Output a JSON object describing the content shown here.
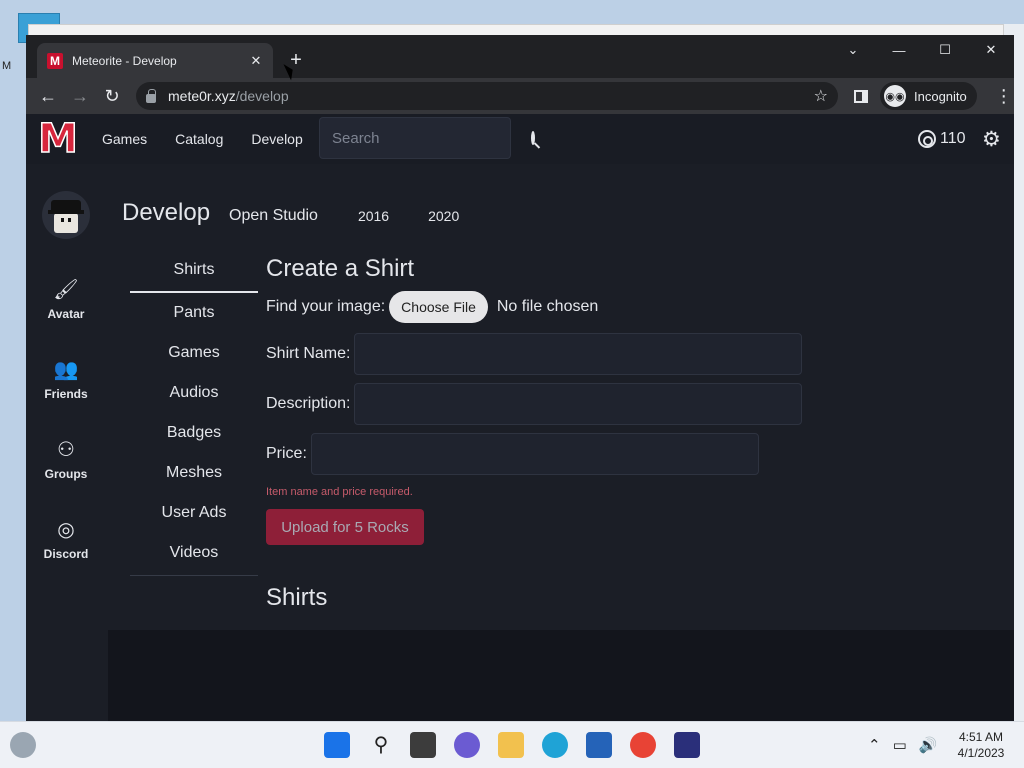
{
  "desktop": {
    "partial_label": "M"
  },
  "browser": {
    "tab_title": "Meteorite - Develop",
    "favicon_letter": "M",
    "url_host": "mete0r.xyz",
    "url_path": "/develop",
    "incognito_label": "Incognito"
  },
  "site": {
    "logo_letter": "M",
    "nav": [
      "Games",
      "Catalog",
      "Develop"
    ],
    "search_placeholder": "Search",
    "rocks": "110"
  },
  "sidebar": {
    "items": [
      {
        "label": "Avatar",
        "icon": "brush-icon"
      },
      {
        "label": "Friends",
        "icon": "friends-icon"
      },
      {
        "label": "Groups",
        "icon": "groups-icon"
      },
      {
        "label": "Discord",
        "icon": "discord-icon"
      }
    ]
  },
  "develop": {
    "title": "Develop",
    "open_studio": "Open Studio",
    "versions": [
      "2016",
      "2020"
    ],
    "subnav": [
      "Shirts",
      "Pants",
      "Games",
      "Audios",
      "Badges",
      "Meshes",
      "User Ads",
      "Videos"
    ],
    "active_subnav": "Shirts"
  },
  "form": {
    "title": "Create a Shirt",
    "find_image_label": "Find your image:",
    "choose_file": "Choose File",
    "no_file": "No file chosen",
    "name_label": "Shirt Name:",
    "description_label": "Description:",
    "price_label": "Price:",
    "hint": "Item name and price required.",
    "upload_button": "Upload for 5 Rocks"
  },
  "list": {
    "title": "Shirts"
  },
  "taskbar": {
    "time": "4:51 AM",
    "date": "4/1/2023"
  },
  "colors": {
    "accent": "#8e1f38",
    "logo": "#d7263d",
    "page_bg": "#1b1e26"
  }
}
